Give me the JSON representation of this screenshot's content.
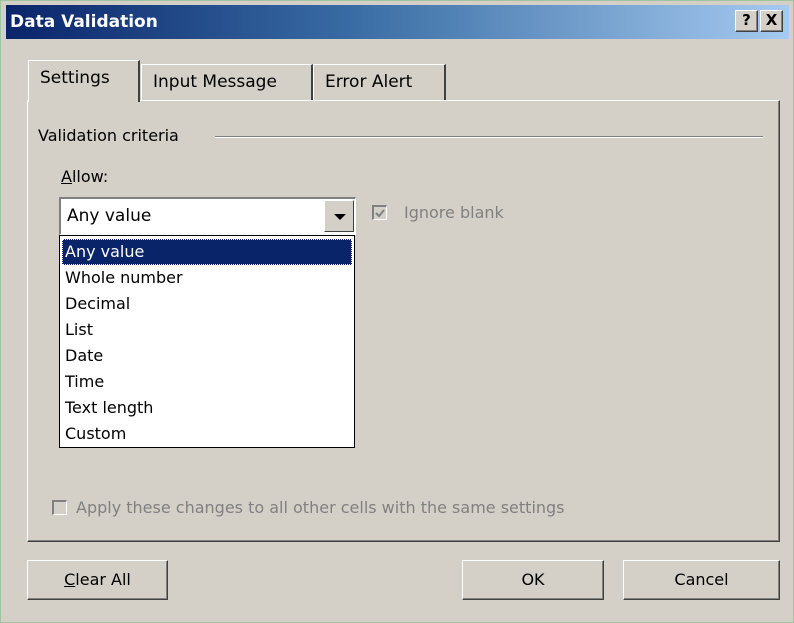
{
  "window": {
    "title": "Data Validation",
    "help_label": "?",
    "close_label": "X"
  },
  "tabs": [
    {
      "label": "Settings",
      "active": true
    },
    {
      "label": "Input Message",
      "active": false
    },
    {
      "label": "Error Alert",
      "active": false
    }
  ],
  "settings": {
    "group_label": "Validation criteria",
    "allow_label_prefix": "A",
    "allow_label_rest": "llow:",
    "allow_value": "Any value",
    "ignore_blank_label": "Ignore blank",
    "ignore_blank_checked": true,
    "ignore_blank_enabled": false,
    "allow_options": [
      "Any value",
      "Whole number",
      "Decimal",
      "List",
      "Date",
      "Time",
      "Text length",
      "Custom"
    ],
    "selected_option": "Any value",
    "apply_label": "Apply these changes to all other cells with the same settings",
    "apply_checked": false,
    "apply_enabled": false
  },
  "buttons": {
    "clear_prefix": "C",
    "clear_rest": "lear All",
    "ok_label": "OK",
    "cancel_label": "Cancel"
  },
  "colors": {
    "titlebar_start": "#0a246a",
    "titlebar_end": "#a6caf0",
    "face": "#d4d0c8",
    "selection": "#0a246a",
    "disabled_text": "#808080"
  }
}
